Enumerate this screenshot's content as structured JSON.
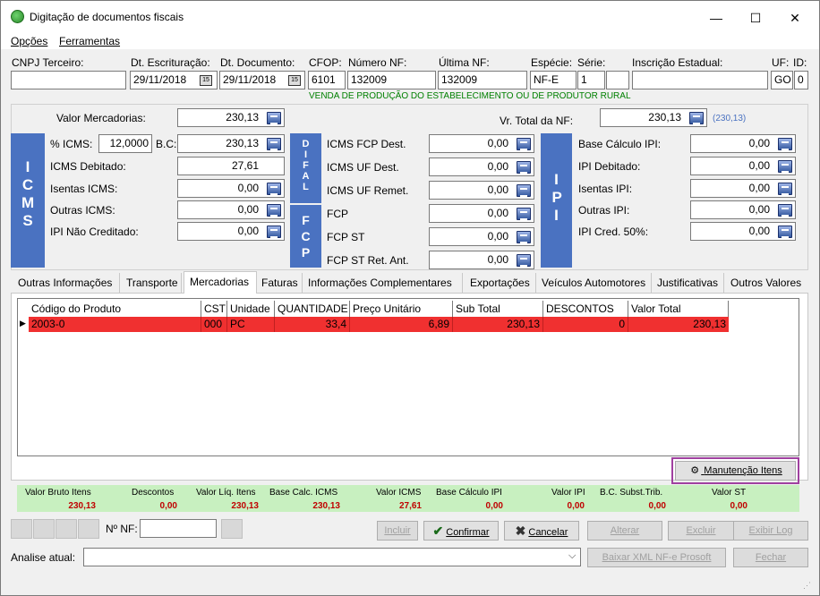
{
  "window": {
    "title": "Digitação de documentos fiscais",
    "min": "—",
    "max": "☐",
    "close": "✕"
  },
  "menu": [
    "Opções",
    "Ferramentas"
  ],
  "header": {
    "cnpj_label": "CNPJ Terceiro:",
    "cnpj_value": "",
    "dt_escrit_label": "Dt. Escrituração:",
    "dt_escrit_value": "29/11/2018",
    "dt_doc_label": "Dt. Documento:",
    "dt_doc_value": "29/11/2018",
    "cfop_label": "CFOP:",
    "cfop_value": "6101",
    "numero_label": "Número NF:",
    "numero_value": "132009",
    "ultima_label": "Última NF:",
    "ultima_value": "132009",
    "especie_label": "Espécie:",
    "especie_value": "NF-E",
    "serie_label": "Série:",
    "serie_value": "1",
    "ie_label": "Inscrição Estadual:",
    "ie_value": "",
    "uf_label": "UF:",
    "uf_value": "GO",
    "id_label": "ID:",
    "id_value": "0",
    "cfop_desc": "VENDA DE PRODUÇÃO DO ESTABELECIMENTO OU DE PRODUTOR RURAL"
  },
  "valores": {
    "valor_merc_label": "Valor Mercadorias:",
    "valor_merc": "230,13",
    "vr_total_label": "Vr. Total da NF:",
    "vr_total": "230,13",
    "vr_total_hint": "(230,13)"
  },
  "icms": {
    "bar": "ICMS",
    "pct_label": "% ICMS:",
    "pct": "12,0000",
    "bc_label": "B.C:",
    "bc": "230,13",
    "debitado_label": "ICMS Debitado:",
    "debitado": "27,61",
    "isentas_label": "Isentas ICMS:",
    "isentas": "0,00",
    "outras_label": "Outras ICMS:",
    "outras": "0,00",
    "ipi_nc_label": "IPI Não Creditado:",
    "ipi_nc": "0,00"
  },
  "difal": {
    "bar": "DIFAL",
    "fcp_bar": "FCP",
    "fcp_dest_label": "ICMS FCP Dest.",
    "fcp_dest": "0,00",
    "uf_dest_label": "ICMS UF Dest.",
    "uf_dest": "0,00",
    "uf_remet_label": "ICMS UF Remet.",
    "uf_remet": "0,00",
    "fcp_label": "FCP",
    "fcp": "0,00",
    "fcp_st_label": "FCP ST",
    "fcp_st": "0,00",
    "fcp_st_ret_label": "FCP ST Ret. Ant.",
    "fcp_st_ret": "0,00"
  },
  "ipi": {
    "bar": "IPI",
    "base_label": "Base Cálculo IPI:",
    "base": "0,00",
    "debitado_label": "IPI Debitado:",
    "debitado": "0,00",
    "isentas_label": "Isentas IPI:",
    "isentas": "0,00",
    "outras_label": "Outras IPI:",
    "outras": "0,00",
    "cred_label": "IPI Cred. 50%:",
    "cred": "0,00"
  },
  "tabs": [
    "Outras Informações",
    "Transporte",
    "Mercadorias",
    "Faturas",
    "Informações Complementares",
    "Exportações",
    "Veículos Automotores",
    "Justificativas",
    "Outros Valores"
  ],
  "grid": {
    "columns": [
      "Código do Produto",
      "CST",
      "Unidade",
      "QUANTIDADE",
      "Preço Unitário",
      "Sub Total",
      "DESCONTOS",
      "Valor Total"
    ],
    "rows": [
      [
        "2003-0",
        "000",
        "PC",
        "33,4",
        "6,89",
        "230,13",
        "0",
        "230,13"
      ]
    ],
    "row_marker": "▶"
  },
  "manutencao_label": "Manutenção Itens",
  "totals": {
    "labels": [
      "Valor Bruto Itens",
      "Descontos",
      "Valor Líq. Itens",
      "Base Calc. ICMS",
      "Valor ICMS",
      "Base Cálculo IPI",
      "Valor IPI",
      "B.C. Subst.Trib.",
      "Valor ST"
    ],
    "values": [
      "230,13",
      "0,00",
      "230,13",
      "230,13",
      "27,61",
      "0,00",
      "0,00",
      "0,00",
      "0,00"
    ]
  },
  "bottom": {
    "nf_label": "Nº NF:",
    "nf_value": "",
    "incluir": "Incluir",
    "confirmar": "Confirmar",
    "cancelar": "Cancelar",
    "alterar": "Alterar",
    "excluir": "Excluir",
    "exibir_log": "Exibir Log",
    "analise_label": "Analise atual:",
    "analise_value": "",
    "baixar_xml": "Baixar XML NF-e Prosoft",
    "fechar": "Fechar"
  },
  "colors": {
    "grid_row": "#f03030",
    "totals_bg": "#c8f0c0",
    "bar_blue": "#4a72c1",
    "cfop_desc": "#008000",
    "highlight": "#a040a0"
  }
}
